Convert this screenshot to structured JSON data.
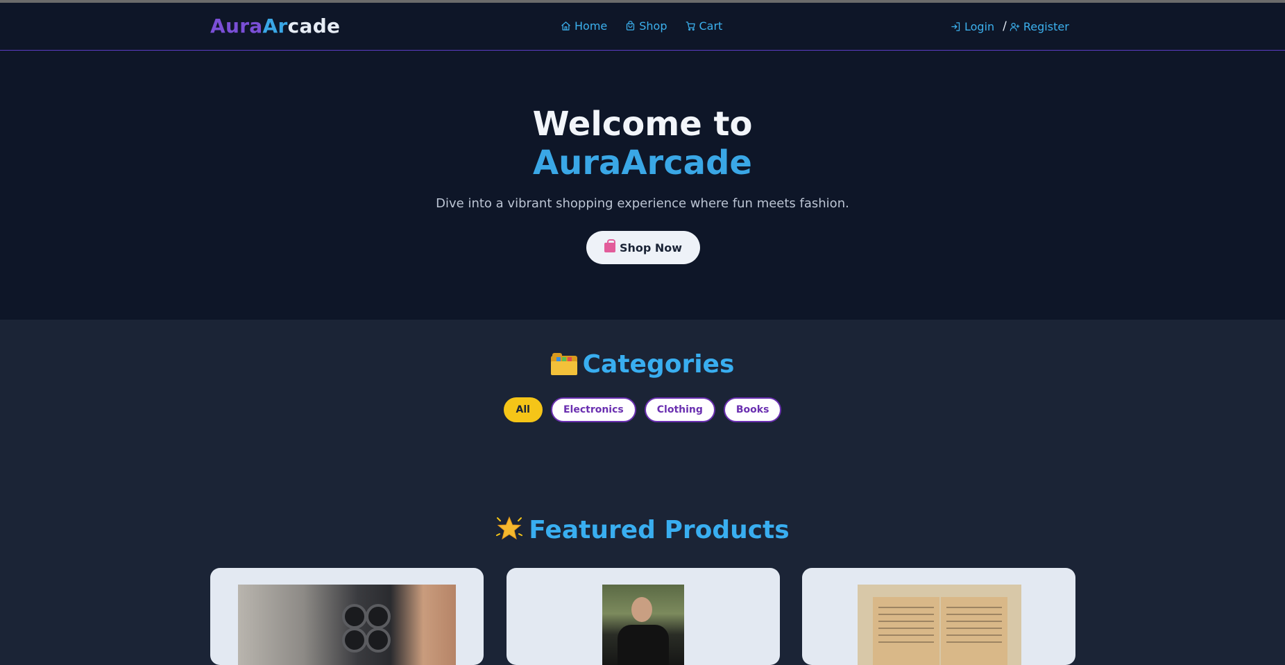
{
  "brand": {
    "part1": "Aura",
    "part2": "Ar",
    "part3": "cade"
  },
  "nav": {
    "home": "Home",
    "shop": "Shop",
    "cart": "Cart"
  },
  "auth": {
    "login": "Login",
    "separator": "/",
    "register": "Register"
  },
  "hero": {
    "heading_line1": "Welcome to",
    "heading_brand": "AuraArcade",
    "subtitle": "Dive into a vibrant shopping experience where fun meets fashion.",
    "cta_label": "Shop Now",
    "cta_icon": "shopping-bags-emoji"
  },
  "categories": {
    "title": "Categories",
    "title_icon": "card-index-dividers-emoji",
    "items": [
      "All",
      "Electronics",
      "Clothing",
      "Books"
    ],
    "active": "All"
  },
  "featured": {
    "title": "Featured Products",
    "title_icon": "glowing-star-emoji",
    "products": [
      {
        "image": "smartphone-photo"
      },
      {
        "image": "clothing-model-photo"
      },
      {
        "image": "open-book-photo"
      }
    ]
  },
  "colors": {
    "background": "#1b2436",
    "header_bg": "#0e1628",
    "accent_blue": "#3aa7e6",
    "accent_purple": "#6a2fb0",
    "active_chip": "#f5c518",
    "card_bg": "#e3e9f2"
  }
}
